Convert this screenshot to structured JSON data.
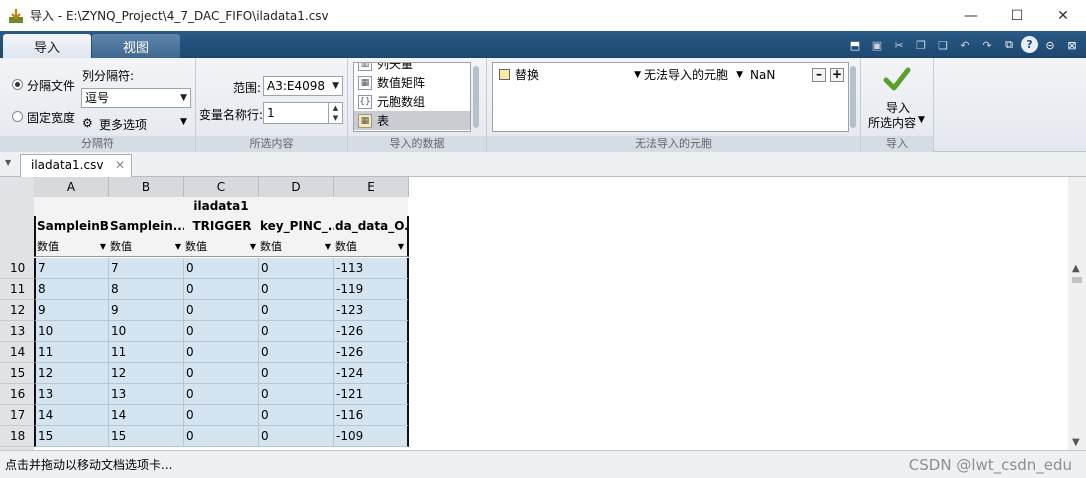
{
  "window": {
    "title": "导入 - E:\\ZYNQ_Project\\4_7_DAC_FIFO\\iladata1.csv",
    "minimize": "—",
    "maximize": "☐",
    "close": "✕"
  },
  "ribbon_tabs": [
    "导入",
    "视图"
  ],
  "quick_access": [
    "import-data-icon",
    "save-icon",
    "cut-icon",
    "copy-icon",
    "paste-icon",
    "undo-icon",
    "redo-icon",
    "switch-window-icon",
    "help-icon",
    "expand-icon",
    "close-icon"
  ],
  "delimiter_group": {
    "label": "分隔符",
    "radio_delimited": "分隔文件",
    "radio_fixed": "固定宽度",
    "selected": "分隔文件",
    "column_delimiter_label": "列分隔符:",
    "column_delimiter_value": "逗号",
    "more_options": "更多选项"
  },
  "selection_group": {
    "label": "所选内容",
    "range_label": "范围:",
    "range_value": "A3:E4098",
    "varnames_row_label": "变量名称行:",
    "varnames_row_value": "1"
  },
  "imported_data_group": {
    "label": "导入的数据",
    "options": [
      "列矢量",
      "数值矩阵",
      "元胞数组",
      "表"
    ],
    "selected": "表"
  },
  "unimportable_group": {
    "label": "无法导入的元胞",
    "rule_action": "替换",
    "rule_target": "无法导入的元胞",
    "rule_value": "NaN",
    "minus": "–",
    "plus": "+"
  },
  "import_group": {
    "label": "导入",
    "button_line1": "导入",
    "button_line2": "所选内容"
  },
  "document_tab": {
    "name": "iladata1.csv",
    "close": "✕"
  },
  "grid": {
    "dataset_name": "iladata1",
    "column_letters": [
      "A",
      "B",
      "C",
      "D",
      "E"
    ],
    "variable_names": [
      "SampleinB...",
      "Samplein...",
      "TRIGGER",
      "key_PINC_...",
      "da_data_O..."
    ],
    "types": [
      "数值",
      "数值",
      "数值",
      "数值",
      "数值"
    ],
    "row_numbers": [
      "10",
      "11",
      "12",
      "13",
      "14",
      "15",
      "16",
      "17",
      "18"
    ],
    "rows": [
      [
        "7",
        "7",
        "0",
        "0",
        "-113"
      ],
      [
        "8",
        "8",
        "0",
        "0",
        "-119"
      ],
      [
        "9",
        "9",
        "0",
        "0",
        "-123"
      ],
      [
        "10",
        "10",
        "0",
        "0",
        "-126"
      ],
      [
        "11",
        "11",
        "0",
        "0",
        "-126"
      ],
      [
        "12",
        "12",
        "0",
        "0",
        "-124"
      ],
      [
        "13",
        "13",
        "0",
        "0",
        "-121"
      ],
      [
        "14",
        "14",
        "0",
        "0",
        "-116"
      ],
      [
        "15",
        "15",
        "0",
        "0",
        "-109"
      ]
    ]
  },
  "status": "点击并拖动以移动文档选项卡...",
  "watermark": "CSDN @lwt_csdn_edu"
}
